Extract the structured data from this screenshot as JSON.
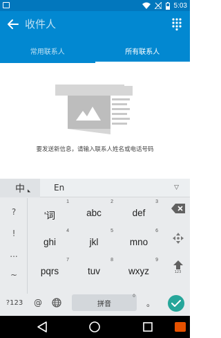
{
  "status_bar": {
    "time": "5:03",
    "icons": [
      "image-notification-icon",
      "wifi-icon",
      "signal-off-icon",
      "battery-icon"
    ]
  },
  "app_bar": {
    "search_placeholder": "收件人",
    "back_icon": "back-arrow-icon",
    "dialpad_icon": "dialpad-icon"
  },
  "tabs": [
    {
      "label": "常用联系人",
      "active": false
    },
    {
      "label": "所有联系人",
      "active": true
    }
  ],
  "empty_state": {
    "hint": "要发送新信息，请输入联系人姓名或电话号码"
  },
  "keyboard": {
    "ime_chinese": "中",
    "ime_english": "En",
    "collapse_icon": "▽",
    "side_keys": [
      "?",
      "!",
      "...",
      "~"
    ],
    "keys": [
      {
        "label": "'词",
        "num": "1"
      },
      {
        "label": "abc",
        "num": "2"
      },
      {
        "label": "def",
        "num": "3"
      },
      {
        "label": "ghi",
        "num": "4"
      },
      {
        "label": "jkl",
        "num": "5"
      },
      {
        "label": "mno",
        "num": "6"
      },
      {
        "label": "pqrs",
        "num": "7"
      },
      {
        "label": "tuv",
        "num": "8"
      },
      {
        "label": "wxyz",
        "num": "9"
      }
    ],
    "symbols_key": "?123",
    "at_key": "@",
    "space_label": "拼音",
    "zero_num": "0",
    "period_key": "。",
    "action_icons": [
      "backspace-icon",
      "cursor-move-icon",
      "shift-icon",
      "enter-check-icon"
    ],
    "shift_hint": "123"
  },
  "colors": {
    "status_bar": "#0277bd",
    "app_bar": "#0288d1",
    "enter_key": "#26a69a",
    "keyboard_bg": "#e9ebed"
  }
}
